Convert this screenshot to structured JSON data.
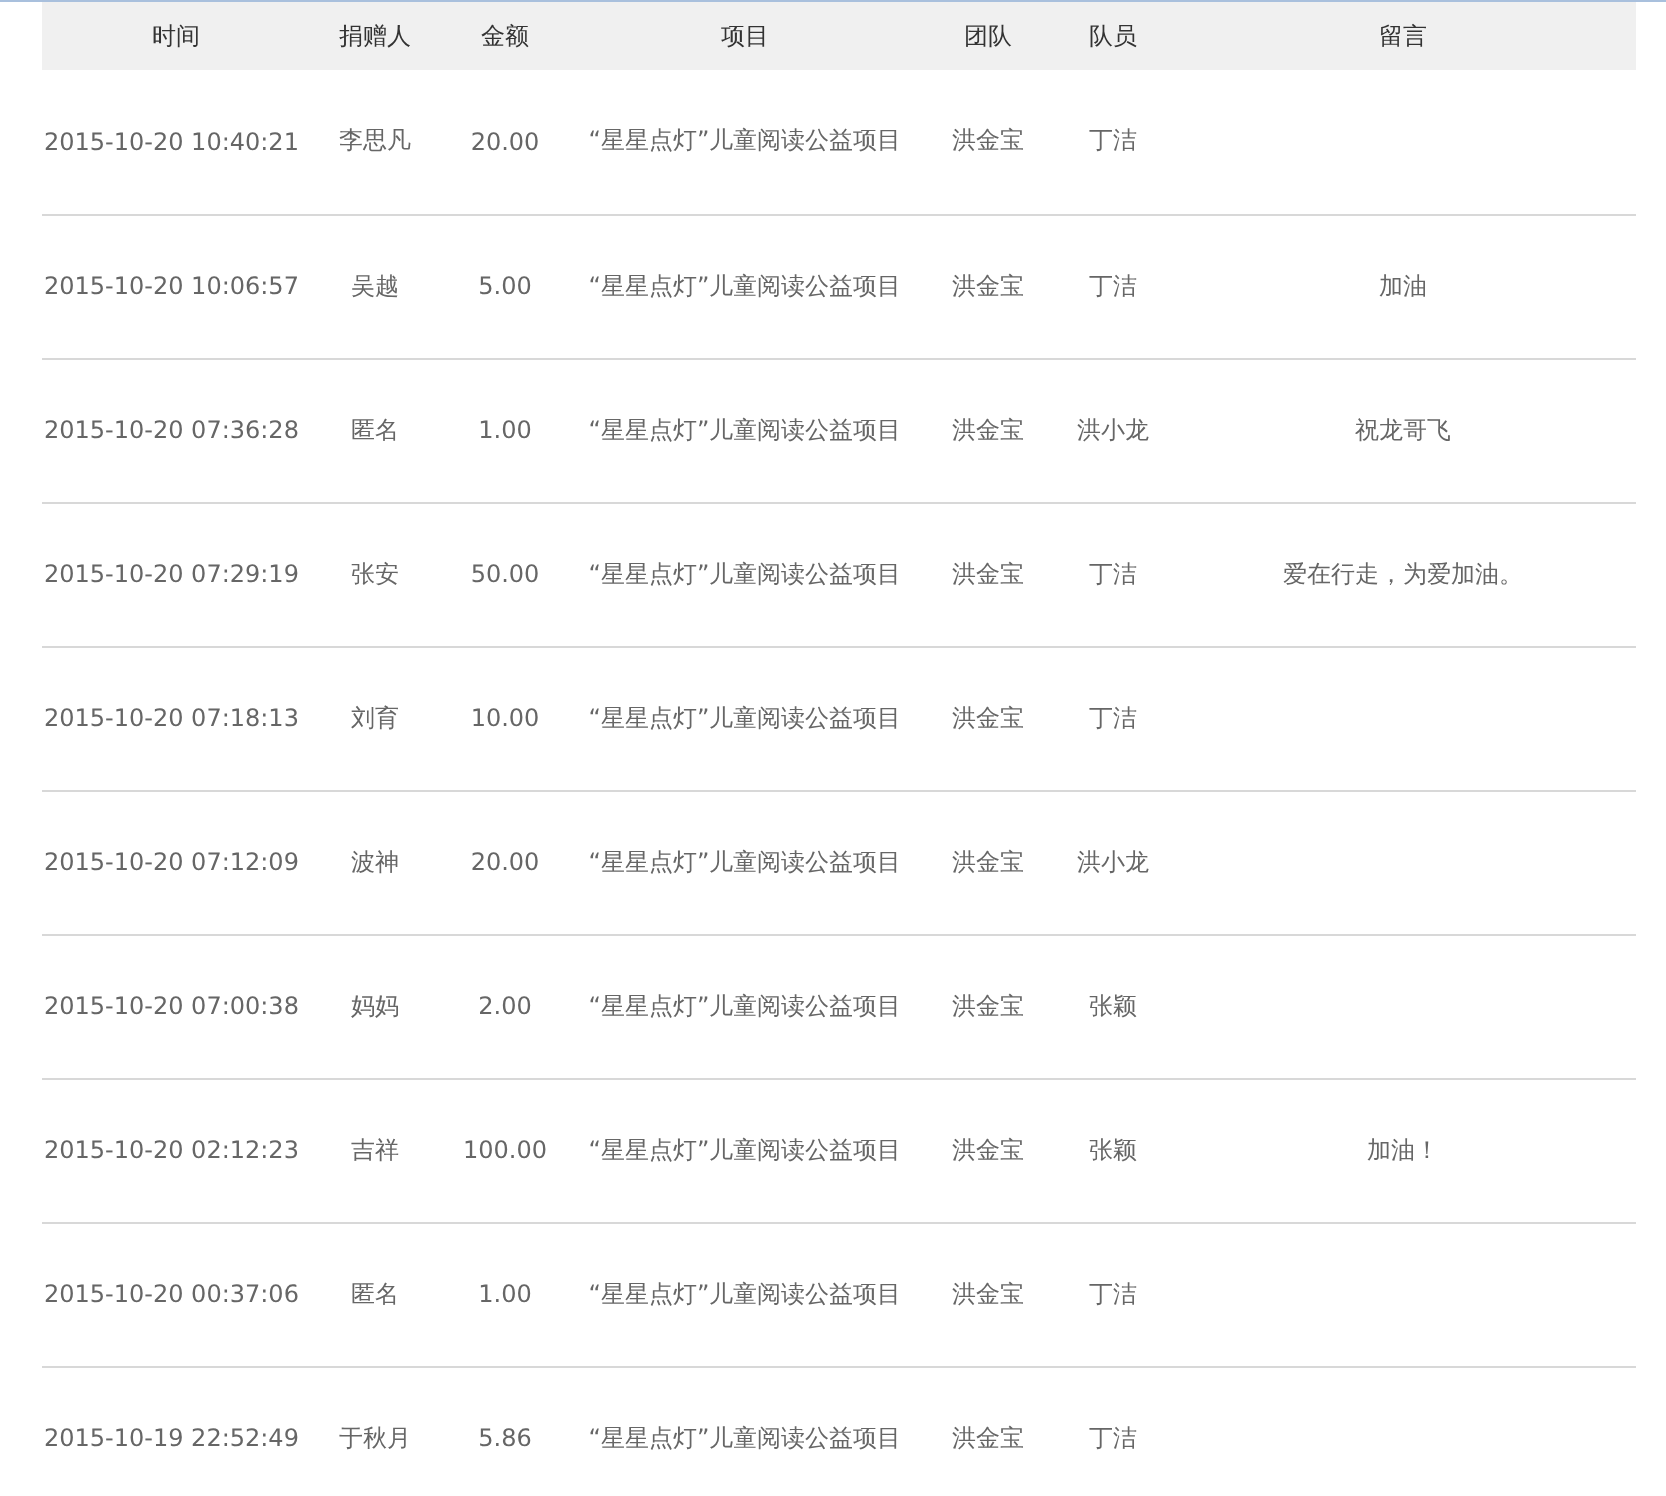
{
  "table": {
    "columns": [
      "时间",
      "捐赠人",
      "金额",
      "项目",
      "团队",
      "队员",
      "留言"
    ],
    "rows": [
      {
        "time": "2015-10-20 10:40:21",
        "donor": "李思凡",
        "amount": "20.00",
        "project": "“星星点灯”儿童阅读公益项目",
        "team": "洪金宝",
        "member": "丁洁"
      },
      {
        "time": "2015-10-20 10:06:57",
        "donor": "吴越",
        "amount": "5.00",
        "project": "“星星点灯”儿童阅读公益项目",
        "team": "洪金宝",
        "member": "丁洁",
        "message": "加油"
      },
      {
        "time": "2015-10-20 07:36:28",
        "donor": "匿名",
        "amount": "1.00",
        "project": "“星星点灯”儿童阅读公益项目",
        "team": "洪金宝",
        "member": "洪小龙",
        "message": "祝龙哥飞"
      },
      {
        "time": "2015-10-20 07:29:19",
        "donor": "张安",
        "amount": "50.00",
        "project": "“星星点灯”儿童阅读公益项目",
        "team": "洪金宝",
        "member": "丁洁",
        "message": "爱在行走，为爱加油。"
      },
      {
        "time": "2015-10-20 07:18:13",
        "donor": "刘育",
        "amount": "10.00",
        "project": "“星星点灯”儿童阅读公益项目",
        "team": "洪金宝",
        "member": "丁洁"
      },
      {
        "time": "2015-10-20 07:12:09",
        "donor": "波神",
        "amount": "20.00",
        "project": "“星星点灯”儿童阅读公益项目",
        "team": "洪金宝",
        "member": "洪小龙"
      },
      {
        "time": "2015-10-20 07:00:38",
        "donor": "妈妈",
        "amount": "2.00",
        "project": "“星星点灯”儿童阅读公益项目",
        "team": "洪金宝",
        "member": "张颖"
      },
      {
        "time": "2015-10-20 02:12:23",
        "donor": "吉祥",
        "amount": "100.00",
        "project": "“星星点灯”儿童阅读公益项目",
        "team": "洪金宝",
        "member": "张颖",
        "message": "加油！"
      },
      {
        "time": "2015-10-20 00:37:06",
        "donor": "匿名",
        "amount": "1.00",
        "project": "“星星点灯”儿童阅读公益项目",
        "team": "洪金宝",
        "member": "丁洁"
      },
      {
        "time": "2015-10-19 22:52:49",
        "donor": "于秋月",
        "amount": "5.86",
        "project": "“星星点灯”儿童阅读公益项目",
        "team": "洪金宝",
        "member": "丁洁"
      }
    ]
  }
}
